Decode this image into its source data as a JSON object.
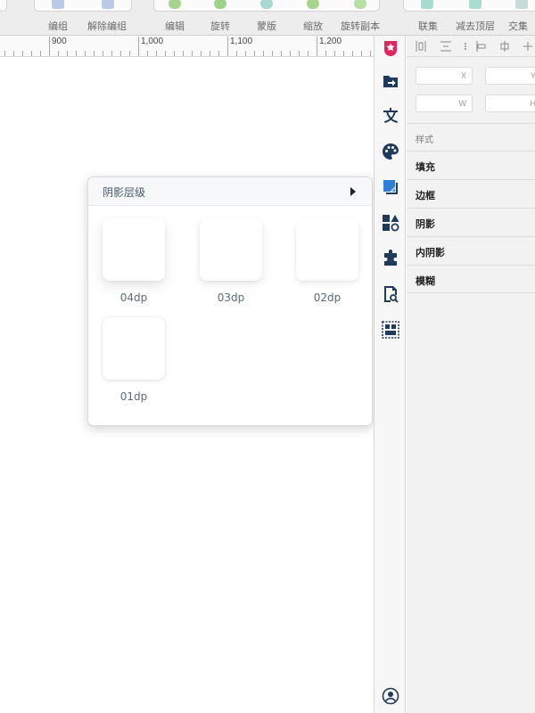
{
  "toolbar": {
    "items": [
      {
        "label": "编组",
        "icon": "group-icon"
      },
      {
        "label": "解除编组",
        "icon": "ungroup-icon"
      },
      {
        "label": "编辑",
        "icon": "edit-icon"
      },
      {
        "label": "旋转",
        "icon": "rotate-icon"
      },
      {
        "label": "蒙版",
        "icon": "mask-icon"
      },
      {
        "label": "缩放",
        "icon": "scale-icon"
      },
      {
        "label": "旋转副本",
        "icon": "rotate-copy-icon"
      },
      {
        "label": "联集",
        "icon": "union-icon"
      },
      {
        "label": "减去顶层",
        "icon": "subtract-icon"
      },
      {
        "label": "交集",
        "icon": "intersect-icon"
      }
    ]
  },
  "ruler": {
    "labels": [
      "900",
      "1,000",
      "1,100",
      "1,200"
    ]
  },
  "shadow_popover": {
    "title": "阴影层级",
    "levels": [
      {
        "label": "04dp"
      },
      {
        "label": "03dp"
      },
      {
        "label": "02dp"
      },
      {
        "label": "01dp"
      }
    ]
  },
  "inspector": {
    "fields": {
      "x": "X",
      "y": "Y",
      "w": "W",
      "h": "H"
    },
    "section_label": "样式",
    "properties": [
      "填充",
      "边框",
      "阴影",
      "内阴影",
      "模糊"
    ]
  },
  "strip_icons": [
    "star-plugin-icon",
    "export-icon",
    "text-icon",
    "palette-icon",
    "shadow-icon",
    "shapes-icon",
    "puzzle-icon",
    "search-layer-icon",
    "layout-grid-icon",
    "account-icon"
  ],
  "colors": {
    "accent": "#2f7fd8",
    "brand": "#e0245e"
  }
}
